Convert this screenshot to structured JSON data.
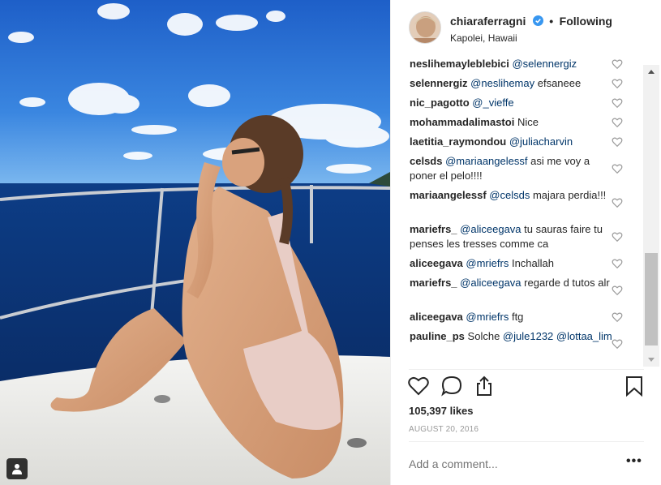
{
  "post": {
    "username": "chiaraferragni",
    "separator": "•",
    "follow_label": "Following",
    "location": "Kapolei, Hawaii",
    "likes": "105,397 likes",
    "date": "AUGUST 20, 2016",
    "add_comment_placeholder": "Add a comment...",
    "more_label": "•••"
  },
  "comments": [
    {
      "user": "neslihemayleblebici",
      "mention": "@selennergiz",
      "text": ""
    },
    {
      "user": "selennergiz",
      "mention": "@neslihemay",
      "text": "efsaneee"
    },
    {
      "user": "nic_pagotto",
      "mention": "@_vieffe",
      "text": ""
    },
    {
      "user": "mohammadalimastoi",
      "mention": "",
      "text": "Nice"
    },
    {
      "user": "laetitia_raymondou",
      "mention": "@juliacharvin",
      "text": ""
    },
    {
      "user": "celsds",
      "mention": "@mariaangelessf",
      "text": "asi me voy a poner el pelo!!!!"
    },
    {
      "user": "mariaangelessf",
      "mention": "@celsds",
      "text": "majara perdia!!!"
    },
    {
      "user": "mariefrs_",
      "mention": "@aliceegava",
      "text": "tu sauras faire tu penses les tresses comme ca"
    },
    {
      "user": "aliceegava",
      "mention": "@mriefrs",
      "text": "Inchallah"
    },
    {
      "user": "mariefrs_",
      "mention": "@aliceegava",
      "text": "regarde d tutos alr"
    },
    {
      "user": "aliceegava",
      "mention": "@mriefrs",
      "text": "ftg"
    },
    {
      "user": "pauline_ps",
      "mention": "@jule1232",
      "text": "Solche",
      "mention2": "@lottaa_lim"
    }
  ],
  "icons": {
    "like": "heart-icon",
    "comment": "speech-bubble-icon",
    "share": "share-icon",
    "save": "bookmark-icon",
    "verified": "verified-badge-icon",
    "tag": "user-tag-icon"
  },
  "colors": {
    "text": "#262626",
    "mention": "#003569",
    "muted": "#999999",
    "verified": "#3897f0",
    "border": "#efefef"
  }
}
